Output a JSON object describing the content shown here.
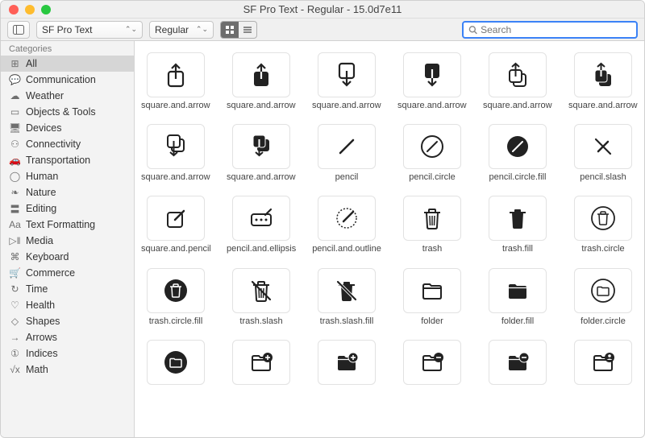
{
  "window": {
    "title": "SF Pro Text - Regular - 15.0d7e11"
  },
  "toolbar": {
    "font_select": "SF Pro Text",
    "weight_select": "Regular",
    "view_mode": "grid",
    "search_placeholder": "Search"
  },
  "sidebar": {
    "header": "Categories",
    "items": [
      {
        "icon": "grid-3x3-icon",
        "glyph": "⊞",
        "label": "All",
        "selected": true
      },
      {
        "icon": "speech-bubble-icon",
        "glyph": "💬",
        "label": "Communication"
      },
      {
        "icon": "cloud-icon",
        "glyph": "☁︎",
        "label": "Weather"
      },
      {
        "icon": "folder-icon",
        "glyph": "▭",
        "label": "Objects & Tools"
      },
      {
        "icon": "desktop-icon",
        "glyph": "🖥",
        "label": "Devices"
      },
      {
        "icon": "wifi-icon",
        "glyph": "⚇",
        "label": "Connectivity"
      },
      {
        "icon": "car-icon",
        "glyph": "🚗",
        "label": "Transportation"
      },
      {
        "icon": "person-icon",
        "glyph": "◯",
        "label": "Human"
      },
      {
        "icon": "leaf-icon",
        "glyph": "❧",
        "label": "Nature"
      },
      {
        "icon": "slider-icon",
        "glyph": "〓",
        "label": "Editing"
      },
      {
        "icon": "text-formatting-icon",
        "glyph": "Aa",
        "label": "Text Formatting"
      },
      {
        "icon": "play-icon",
        "glyph": "▷ǁ",
        "label": "Media"
      },
      {
        "icon": "keyboard-icon",
        "glyph": "⌘",
        "label": "Keyboard"
      },
      {
        "icon": "cart-icon",
        "glyph": "🛒",
        "label": "Commerce"
      },
      {
        "icon": "clock-icon",
        "glyph": "↻",
        "label": "Time"
      },
      {
        "icon": "heart-icon",
        "glyph": "♡",
        "label": "Health"
      },
      {
        "icon": "shape-icon",
        "glyph": "◇",
        "label": "Shapes"
      },
      {
        "icon": "arrow-icon",
        "glyph": "→",
        "label": "Arrows"
      },
      {
        "icon": "circled-number-icon",
        "glyph": "①",
        "label": "Indices"
      },
      {
        "icon": "function-icon",
        "glyph": "√x",
        "label": "Math"
      }
    ]
  },
  "grid": {
    "items": [
      {
        "svg": "share-up",
        "label": "square.and.arrow.up"
      },
      {
        "svg": "share-up-fill",
        "label": "square.and.arrow.up.fill"
      },
      {
        "svg": "share-down",
        "label": "square.and.arrow.down"
      },
      {
        "svg": "share-down-fill",
        "label": "square.and.arrow.down.fill"
      },
      {
        "svg": "share-up-on",
        "label": "square.and.arrow.up.on.s..."
      },
      {
        "svg": "share-up-on-fill",
        "label": "square.and.arrow.up.on.s..."
      },
      {
        "svg": "share-down-on",
        "label": "square.and.arrow.down.o..."
      },
      {
        "svg": "share-down-on-fill",
        "label": "square.and.arrow.down.o..."
      },
      {
        "svg": "pencil",
        "label": "pencil"
      },
      {
        "svg": "pencil-circle",
        "label": "pencil.circle"
      },
      {
        "svg": "pencil-circle-fill",
        "label": "pencil.circle.fill"
      },
      {
        "svg": "pencil-slash",
        "label": "pencil.slash"
      },
      {
        "svg": "square-pencil",
        "label": "square.and.pencil"
      },
      {
        "svg": "pencil-ellipsis",
        "label": "pencil.and.ellipsis.rectan..."
      },
      {
        "svg": "pencil-outline",
        "label": "pencil.and.outline"
      },
      {
        "svg": "trash",
        "label": "trash"
      },
      {
        "svg": "trash-fill",
        "label": "trash.fill"
      },
      {
        "svg": "trash-circle",
        "label": "trash.circle"
      },
      {
        "svg": "trash-circle-fill",
        "label": "trash.circle.fill"
      },
      {
        "svg": "trash-slash",
        "label": "trash.slash"
      },
      {
        "svg": "trash-slash-fill",
        "label": "trash.slash.fill"
      },
      {
        "svg": "folder",
        "label": "folder"
      },
      {
        "svg": "folder-fill",
        "label": "folder.fill"
      },
      {
        "svg": "folder-circle",
        "label": "folder.circle"
      },
      {
        "svg": "folder-circle-fill",
        "label": ""
      },
      {
        "svg": "folder-plus",
        "label": ""
      },
      {
        "svg": "folder-plus-fill",
        "label": ""
      },
      {
        "svg": "folder-minus",
        "label": ""
      },
      {
        "svg": "folder-minus-fill",
        "label": ""
      },
      {
        "svg": "folder-person",
        "label": ""
      }
    ]
  }
}
